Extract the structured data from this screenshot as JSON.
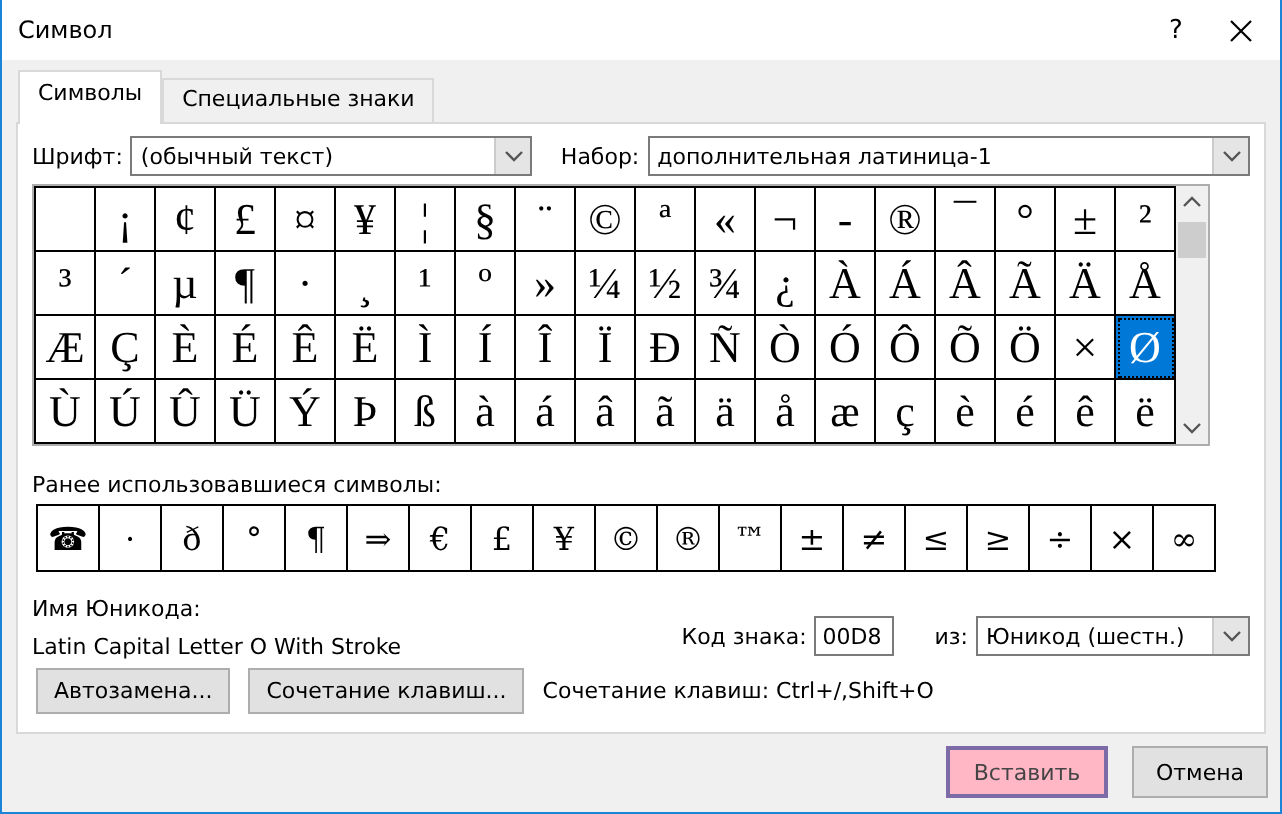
{
  "window": {
    "title": "Символ",
    "help": "?"
  },
  "tabs": [
    {
      "label": "Символы",
      "selected": true
    },
    {
      "label": "Специальные знаки",
      "selected": false
    }
  ],
  "font": {
    "label": "Шрифт:",
    "value": "(обычный текст)"
  },
  "subset": {
    "label": "Набор:",
    "value": "дополнительная латиница-1"
  },
  "grid": [
    [
      {
        "selected": false
      },
      {
        "ch": "¡",
        "selected": false
      },
      {
        "ch": "¢",
        "selected": false
      },
      {
        "ch": "£",
        "selected": false
      },
      {
        "ch": "¤",
        "selected": false
      },
      {
        "ch": "¥",
        "selected": false
      },
      {
        "ch": "¦",
        "selected": false
      },
      {
        "ch": "§",
        "selected": false
      },
      {
        "ch": "¨",
        "selected": false
      },
      {
        "ch": "©",
        "selected": false
      },
      {
        "ch": "ª",
        "selected": false
      },
      {
        "ch": "«",
        "selected": false
      },
      {
        "ch": "¬",
        "selected": false
      },
      {
        "ch": "-",
        "selected": false
      },
      {
        "ch": "®",
        "selected": false
      },
      {
        "ch": "¯",
        "selected": false
      },
      {
        "ch": "°",
        "selected": false
      },
      {
        "ch": "±",
        "selected": false
      },
      {
        "ch": "²",
        "selected": false
      }
    ],
    [
      {
        "ch": "³",
        "selected": false
      },
      {
        "ch": "´",
        "selected": false
      },
      {
        "ch": "µ",
        "selected": false
      },
      {
        "ch": "¶",
        "selected": false
      },
      {
        "ch": "·",
        "selected": false
      },
      {
        "ch": "¸",
        "selected": false
      },
      {
        "ch": "¹",
        "selected": false
      },
      {
        "ch": "º",
        "selected": false
      },
      {
        "ch": "»",
        "selected": false
      },
      {
        "ch": "¼",
        "selected": false
      },
      {
        "ch": "½",
        "selected": false
      },
      {
        "ch": "¾",
        "selected": false
      },
      {
        "ch": "¿",
        "selected": false
      },
      {
        "ch": "À",
        "selected": false
      },
      {
        "ch": "Á",
        "selected": false
      },
      {
        "ch": "Â",
        "selected": false
      },
      {
        "ch": "Ã",
        "selected": false
      },
      {
        "ch": "Ä",
        "selected": false
      },
      {
        "ch": "Å",
        "selected": false
      }
    ],
    [
      {
        "ch": "Æ",
        "selected": false
      },
      {
        "ch": "Ç",
        "selected": false
      },
      {
        "ch": "È",
        "selected": false
      },
      {
        "ch": "É",
        "selected": false
      },
      {
        "ch": "Ê",
        "selected": false
      },
      {
        "ch": "Ë",
        "selected": false
      },
      {
        "ch": "Ì",
        "selected": false
      },
      {
        "ch": "Í",
        "selected": false
      },
      {
        "ch": "Î",
        "selected": false
      },
      {
        "ch": "Ï",
        "selected": false
      },
      {
        "ch": "Ð",
        "selected": false
      },
      {
        "ch": "Ñ",
        "selected": false
      },
      {
        "ch": "Ò",
        "selected": false
      },
      {
        "ch": "Ó",
        "selected": false
      },
      {
        "ch": "Ô",
        "selected": false
      },
      {
        "ch": "Õ",
        "selected": false
      },
      {
        "ch": "Ö",
        "selected": false
      },
      {
        "ch": "×",
        "selected": false
      },
      {
        "ch": "Ø",
        "selected": true
      }
    ],
    [
      {
        "ch": "Ù",
        "selected": false
      },
      {
        "ch": "Ú",
        "selected": false
      },
      {
        "ch": "Û",
        "selected": false
      },
      {
        "ch": "Ü",
        "selected": false
      },
      {
        "ch": "Ý",
        "selected": false
      },
      {
        "ch": "Þ",
        "selected": false
      },
      {
        "ch": "ß",
        "selected": false
      },
      {
        "ch": "à",
        "selected": false
      },
      {
        "ch": "á",
        "selected": false
      },
      {
        "ch": "â",
        "selected": false
      },
      {
        "ch": "ã",
        "selected": false
      },
      {
        "ch": "ä",
        "selected": false
      },
      {
        "ch": "å",
        "selected": false
      },
      {
        "ch": "æ",
        "selected": false
      },
      {
        "ch": "ç",
        "selected": false
      },
      {
        "ch": "è",
        "selected": false
      },
      {
        "ch": "é",
        "selected": false
      },
      {
        "ch": "ê",
        "selected": false
      },
      {
        "ch": "ë",
        "selected": false
      }
    ]
  ],
  "recent": {
    "label": "Ранее использовавшиеся символы:",
    "symbols": [
      "☎",
      "·",
      "ð",
      "°",
      "¶",
      "⇒",
      "€",
      "£",
      "¥",
      "©",
      "®",
      "™",
      "±",
      "≠",
      "≤",
      "≥",
      "÷",
      "×",
      "∞"
    ]
  },
  "unicode_name": {
    "label": "Имя Юникода:",
    "value": "Latin Capital Letter O With Stroke"
  },
  "char_code": {
    "label": "Код знака:",
    "value": "00D8"
  },
  "from": {
    "label": "из:",
    "value": "Юникод (шестн.)"
  },
  "tool_buttons": [
    "Автозамена...",
    "Сочетание клавиш..."
  ],
  "shortcut": "Сочетание клавиш: Ctrl+/,Shift+O",
  "buttons": [
    {
      "label": "Вставить",
      "highlighted": true
    },
    {
      "label": "Отмена",
      "highlighted": false
    }
  ]
}
